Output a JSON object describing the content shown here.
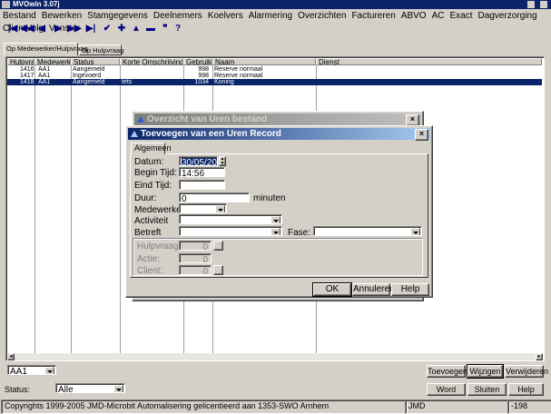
{
  "app": {
    "title": "MVOwin 3.07j",
    "icon": "app-icon"
  },
  "menu": [
    "Bestand",
    "Bewerken",
    "Stamgegevens",
    "Deelnemers",
    "Koelvers",
    "Alarmering",
    "Overzichten",
    "Factureren",
    "ABVO",
    "AC",
    "Exact",
    "Dagverzorging",
    "ClientVolg",
    "Venster"
  ],
  "toolbar": {
    "glyphs": [
      "|◀",
      "◀◀",
      "◀",
      "▶",
      "▶▶",
      "▶|",
      "✔",
      "✚",
      "▲",
      "▬",
      "❞",
      "?"
    ]
  },
  "tabs": {
    "active": "Op Medewerker/Hulpvraag",
    "other": "Op Hulpvraag"
  },
  "table": {
    "columns": [
      "Hulpvraag",
      "Medewerker",
      "Status",
      "Korte Omschrijving",
      "Gebruiker",
      "Naam",
      "Dienst"
    ],
    "rows": [
      {
        "hulpvraag": "1416",
        "medewerker": "AA1",
        "status": "Aangemeld",
        "omschrijving": "",
        "gebruiker": "998",
        "naam": "Reserve normaal",
        "dienst": "",
        "selected": false
      },
      {
        "hulpvraag": "1417",
        "medewerker": "AA1",
        "status": "Ingevoerd",
        "omschrijving": "",
        "gebruiker": "998",
        "naam": "Reserve normaal",
        "dienst": "",
        "selected": false
      },
      {
        "hulpvraag": "1418",
        "medewerker": "AA1",
        "status": "Aangemeld",
        "omschrijving": "tets",
        "gebruiker": "1034",
        "naam": "Koning",
        "dienst": "",
        "selected": true
      }
    ]
  },
  "overzicht_dialog": {
    "title": "Overzicht van Uren bestand"
  },
  "dialog": {
    "title": "Toevoegen van een Uren Record",
    "tab": "Algemeen",
    "fields": {
      "datum": {
        "label": "Datum:",
        "value": "30/05/2005"
      },
      "begin_tijd": {
        "label": "Begin Tijd:",
        "value": "14:56"
      },
      "eind_tijd": {
        "label": "Eind Tijd:",
        "value": ""
      },
      "duur": {
        "label": "Duur:",
        "value": "0",
        "unit": "minuten"
      },
      "medewerker": {
        "label": "Medewerker:",
        "value": ""
      },
      "activiteit": {
        "label": "Activiteit",
        "value": ""
      },
      "betreft": {
        "label": "Betreft",
        "value": ""
      },
      "fase": {
        "label": "Fase:",
        "value": ""
      }
    },
    "disabled_group": {
      "hulpvraag": {
        "label": "Hulpvraag",
        "value": "0"
      },
      "actie": {
        "label": "Actie:",
        "value": "0"
      },
      "client": {
        "label": "Client:",
        "value": "0"
      }
    },
    "buttons": {
      "ok": "OK",
      "annuleren": "Annuleren",
      "help": "Help"
    }
  },
  "bottom": {
    "filter_value": "AA1",
    "buttons": {
      "toevoegen": "Toevoegen",
      "wijzigen": "Wijzigen",
      "verwijderen": "Verwijderen",
      "word": "Word",
      "sluiten": "Sluiten",
      "help": "Help"
    },
    "status_label": "Status:",
    "status_value": "Alle"
  },
  "statusbar": {
    "copyright": "Copyrights 1999-2005 JMD-Microbit Automalisering gelicentieerd aan 1353-SWO Arnhem",
    "user": "JMD",
    "code": "-198"
  }
}
